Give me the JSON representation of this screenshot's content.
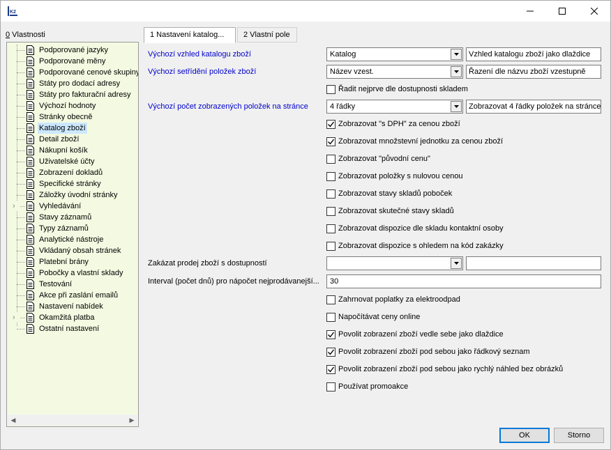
{
  "app": {
    "icon_text": "K2"
  },
  "window_controls": {
    "minimize": "—",
    "maximize": "☐",
    "close": "✕"
  },
  "properties_label": {
    "accel": "0",
    "rest": " Vlastnosti"
  },
  "tree": {
    "items": [
      {
        "label": "Podporované jazyky",
        "expandable": false,
        "selected": false
      },
      {
        "label": "Podporované měny",
        "expandable": false,
        "selected": false
      },
      {
        "label": "Podporované cenové skupiny",
        "expandable": false,
        "selected": false
      },
      {
        "label": "Státy pro dodací adresy",
        "expandable": false,
        "selected": false
      },
      {
        "label": "Státy pro fakturační adresy",
        "expandable": false,
        "selected": false
      },
      {
        "label": "Výchozí hodnoty",
        "expandable": false,
        "selected": false
      },
      {
        "label": "Stránky obecně",
        "expandable": false,
        "selected": false
      },
      {
        "label": "Katalog zboží",
        "expandable": false,
        "selected": true
      },
      {
        "label": "Detail zboží",
        "expandable": false,
        "selected": false
      },
      {
        "label": "Nákupní košík",
        "expandable": false,
        "selected": false
      },
      {
        "label": "Uživatelské účty",
        "expandable": false,
        "selected": false
      },
      {
        "label": "Zobrazení dokladů",
        "expandable": false,
        "selected": false
      },
      {
        "label": "Specifické stránky",
        "expandable": false,
        "selected": false
      },
      {
        "label": "Záložky úvodní stránky",
        "expandable": false,
        "selected": false
      },
      {
        "label": "Vyhledávání",
        "expandable": true,
        "selected": false
      },
      {
        "label": "Stavy záznamů",
        "expandable": false,
        "selected": false
      },
      {
        "label": "Typy záznamů",
        "expandable": false,
        "selected": false
      },
      {
        "label": "Analytické nástroje",
        "expandable": false,
        "selected": false
      },
      {
        "label": "Vkládaný obsah stránek",
        "expandable": false,
        "selected": false
      },
      {
        "label": "Platební brány",
        "expandable": false,
        "selected": false
      },
      {
        "label": "Pobočky a vlastní sklady",
        "expandable": false,
        "selected": false
      },
      {
        "label": "Testování",
        "expandable": false,
        "selected": false
      },
      {
        "label": "Akce při zaslání emailů",
        "expandable": false,
        "selected": false
      },
      {
        "label": "Nastavení nabídek",
        "expandable": false,
        "selected": false
      },
      {
        "label": "Okamžitá platba",
        "expandable": true,
        "selected": false
      },
      {
        "label": "Ostatní nastavení",
        "expandable": false,
        "selected": false
      }
    ],
    "scroll_left": "◀",
    "scroll_right": "▶"
  },
  "tabs": [
    {
      "label": "1 Nastavení katalog...",
      "active": true
    },
    {
      "label": "2 Vlastní pole",
      "active": false
    }
  ],
  "form": {
    "catalog_view": {
      "label": "Výchozí vzhled katalogu zboží",
      "value": "Katalog",
      "description": "Vzhled katalogu zboží jako dlaždice"
    },
    "sort_order": {
      "label": "Výchozí setřídění položek zboží",
      "value": "Název vzest.",
      "description": "Řazení dle názvu zboží vzestupně"
    },
    "sort_availability": {
      "label": "Řadit nejprve dle dostupnosti skladem",
      "checked": false
    },
    "rows_count": {
      "label": "Výchozí počet zobrazených položek na stránce",
      "value": "4 řádky",
      "description": "Zobrazovat 4 řádky položek na stránce"
    },
    "checks_a": [
      {
        "label": "Zobrazovat \"s DPH\" za cenou zboží",
        "checked": true
      },
      {
        "label": "Zobrazovat množstevní jednotku za cenou zboží",
        "checked": true
      },
      {
        "label": "Zobrazovat \"původní cenu\"",
        "checked": false
      },
      {
        "label": "Zobrazovat položky s nulovou cenou",
        "checked": false
      },
      {
        "label": "Zobrazovat stavy skladů poboček",
        "checked": false
      },
      {
        "label": "Zobrazovat skutečné stavy skladů",
        "checked": false
      },
      {
        "label": "Zobrazovat dispozice dle skladu kontaktní osoby",
        "checked": false
      },
      {
        "label": "Zobrazovat dispozice s ohledem na kód zakázky",
        "checked": false
      }
    ],
    "forbid_sale": {
      "label": "Zakázat prodej zboží s dostupností",
      "value": "",
      "description": ""
    },
    "interval": {
      "label": "Interval (počet dnů) pro nápočet nejprodávanejší...",
      "value": "30"
    },
    "checks_b": [
      {
        "label": "Zahrnovat poplatky za elektroodpad",
        "checked": false
      },
      {
        "label": "Napočítávat ceny online",
        "checked": false
      },
      {
        "label": "Povolit zobrazení zboží vedle sebe jako dlaždice",
        "checked": true
      },
      {
        "label": "Povolit zobrazení zboží pod sebou jako řádkový seznam",
        "checked": true
      },
      {
        "label": "Povolit zobrazení zboží pod sebou jako rychlý náhled bez obrázků",
        "checked": true
      },
      {
        "label": "Používat promoakce",
        "checked": false
      }
    ]
  },
  "buttons": {
    "ok": "OK",
    "cancel": "Storno"
  },
  "colors": {
    "tree_bg": "#f3fae1",
    "link_blue": "#0000cc",
    "selection": "#cce8ff",
    "ok_border": "#0078d7"
  }
}
